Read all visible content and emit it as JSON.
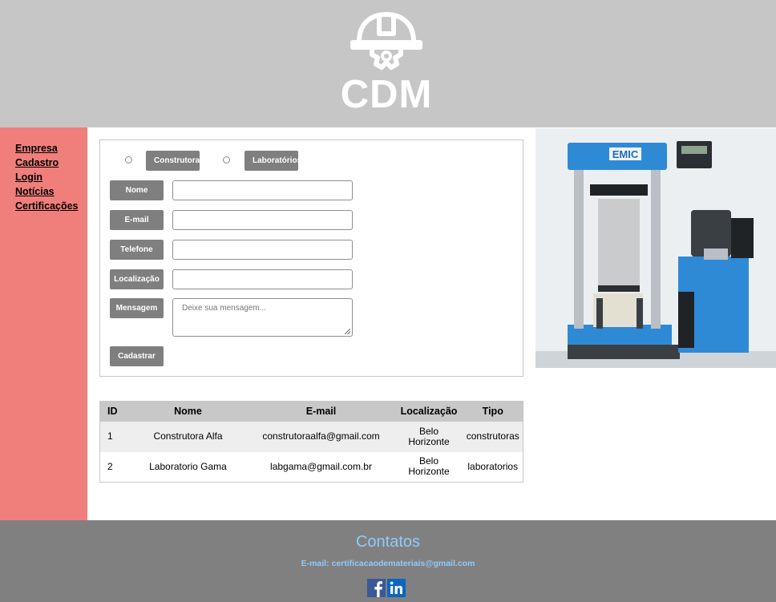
{
  "header": {
    "logo_text": "CDM",
    "logo_icon": "hardhat-gear-icon"
  },
  "sidebar": {
    "items": [
      {
        "label": "Empresa"
      },
      {
        "label": "Cadastro"
      },
      {
        "label": "Login"
      },
      {
        "label": "Notícias"
      },
      {
        "label": "Certificações"
      }
    ]
  },
  "form": {
    "type_options": [
      {
        "label": "Construtoras"
      },
      {
        "label": "Laboratórios"
      }
    ],
    "fields": {
      "nome": {
        "label": "Nome",
        "value": ""
      },
      "email": {
        "label": "E-mail",
        "value": ""
      },
      "telefone": {
        "label": "Telefone",
        "value": ""
      },
      "localizacao": {
        "label": "Localização",
        "value": ""
      },
      "mensagem": {
        "label": "Mensagem",
        "placeholder": "Deixe sua mensagem..."
      }
    },
    "submit_label": "Cadastrar"
  },
  "table": {
    "columns": [
      "ID",
      "Nome",
      "E-mail",
      "Localização",
      "Tipo"
    ],
    "rows": [
      {
        "id": "1",
        "nome": "Construtora Alfa",
        "email": "construtoraalfa@gmail.com",
        "loc1": "Belo",
        "loc2": "Horizonte",
        "tipo": "construtoras"
      },
      {
        "id": "2",
        "nome": "Laboratorio Gama",
        "email": "labgama@gmail.com.br",
        "loc1": "Belo",
        "loc2": "Horizonte",
        "tipo": "laboratorios"
      }
    ]
  },
  "image": {
    "brand": "EMIC"
  },
  "footer": {
    "title": "Contatos",
    "email_text": "E-mail: certificacaodemateriais@gmail.com",
    "social": [
      "facebook-icon",
      "linkedin-icon"
    ]
  },
  "colors": {
    "header_bg": "#c6c6c6",
    "sidebar_bg": "#f07f7b",
    "button_gray": "#7f7f7f",
    "footer_bg": "#808080",
    "footer_accent": "#90caf9"
  }
}
